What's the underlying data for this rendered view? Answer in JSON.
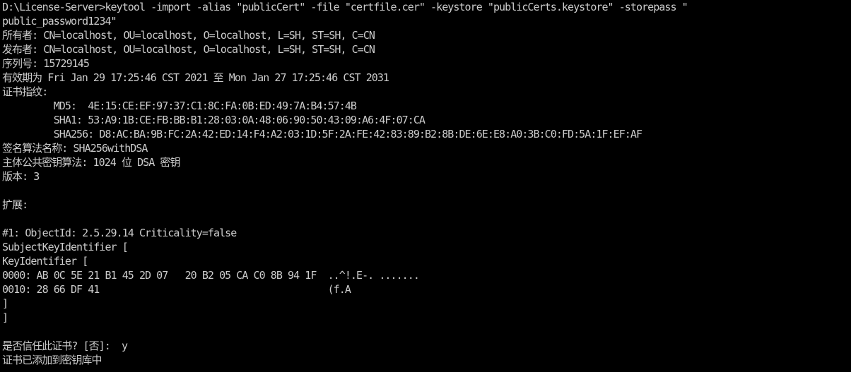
{
  "console": {
    "lines": [
      "D:\\License-Server>keytool -import -alias \"publicCert\" -file \"certfile.cer\" -keystore \"publicCerts.keystore\" -storepass \"",
      "public_password1234\"",
      "所有者: CN=localhost, OU=localhost, O=localhost, L=SH, ST=SH, C=CN",
      "发布者: CN=localhost, OU=localhost, O=localhost, L=SH, ST=SH, C=CN",
      "序列号: 15729145",
      "有效期为 Fri Jan 29 17:25:46 CST 2021 至 Mon Jan 27 17:25:46 CST 2031",
      "证书指纹:",
      "         MD5:  4E:15:CE:EF:97:37:C1:8C:FA:0B:ED:49:7A:B4:57:4B",
      "         SHA1: 53:A9:1B:CE:FB:BB:B1:28:03:0A:48:06:90:50:43:09:A6:4F:07:CA",
      "         SHA256: D8:AC:BA:9B:FC:2A:42:ED:14:F4:A2:03:1D:5F:2A:FE:42:83:89:B2:8B:DE:6E:E8:A0:3B:C0:FD:5A:1F:EF:AF",
      "签名算法名称: SHA256withDSA",
      "主体公共密钥算法: 1024 位 DSA 密钥",
      "版本: 3",
      "",
      "扩展:",
      "",
      "#1: ObjectId: 2.5.29.14 Criticality=false",
      "SubjectKeyIdentifier [",
      "KeyIdentifier [",
      "0000: AB 0C 5E 21 B1 45 2D 07   20 B2 05 CA C0 8B 94 1F  ..^!.E-. .......",
      "0010: 28 66 DF 41                                        (f.A",
      "]",
      "]",
      "",
      "是否信任此证书? [否]:  y",
      "证书已添加到密钥库中"
    ]
  },
  "colors": {
    "background": "#000000",
    "foreground": "#cccccc"
  }
}
